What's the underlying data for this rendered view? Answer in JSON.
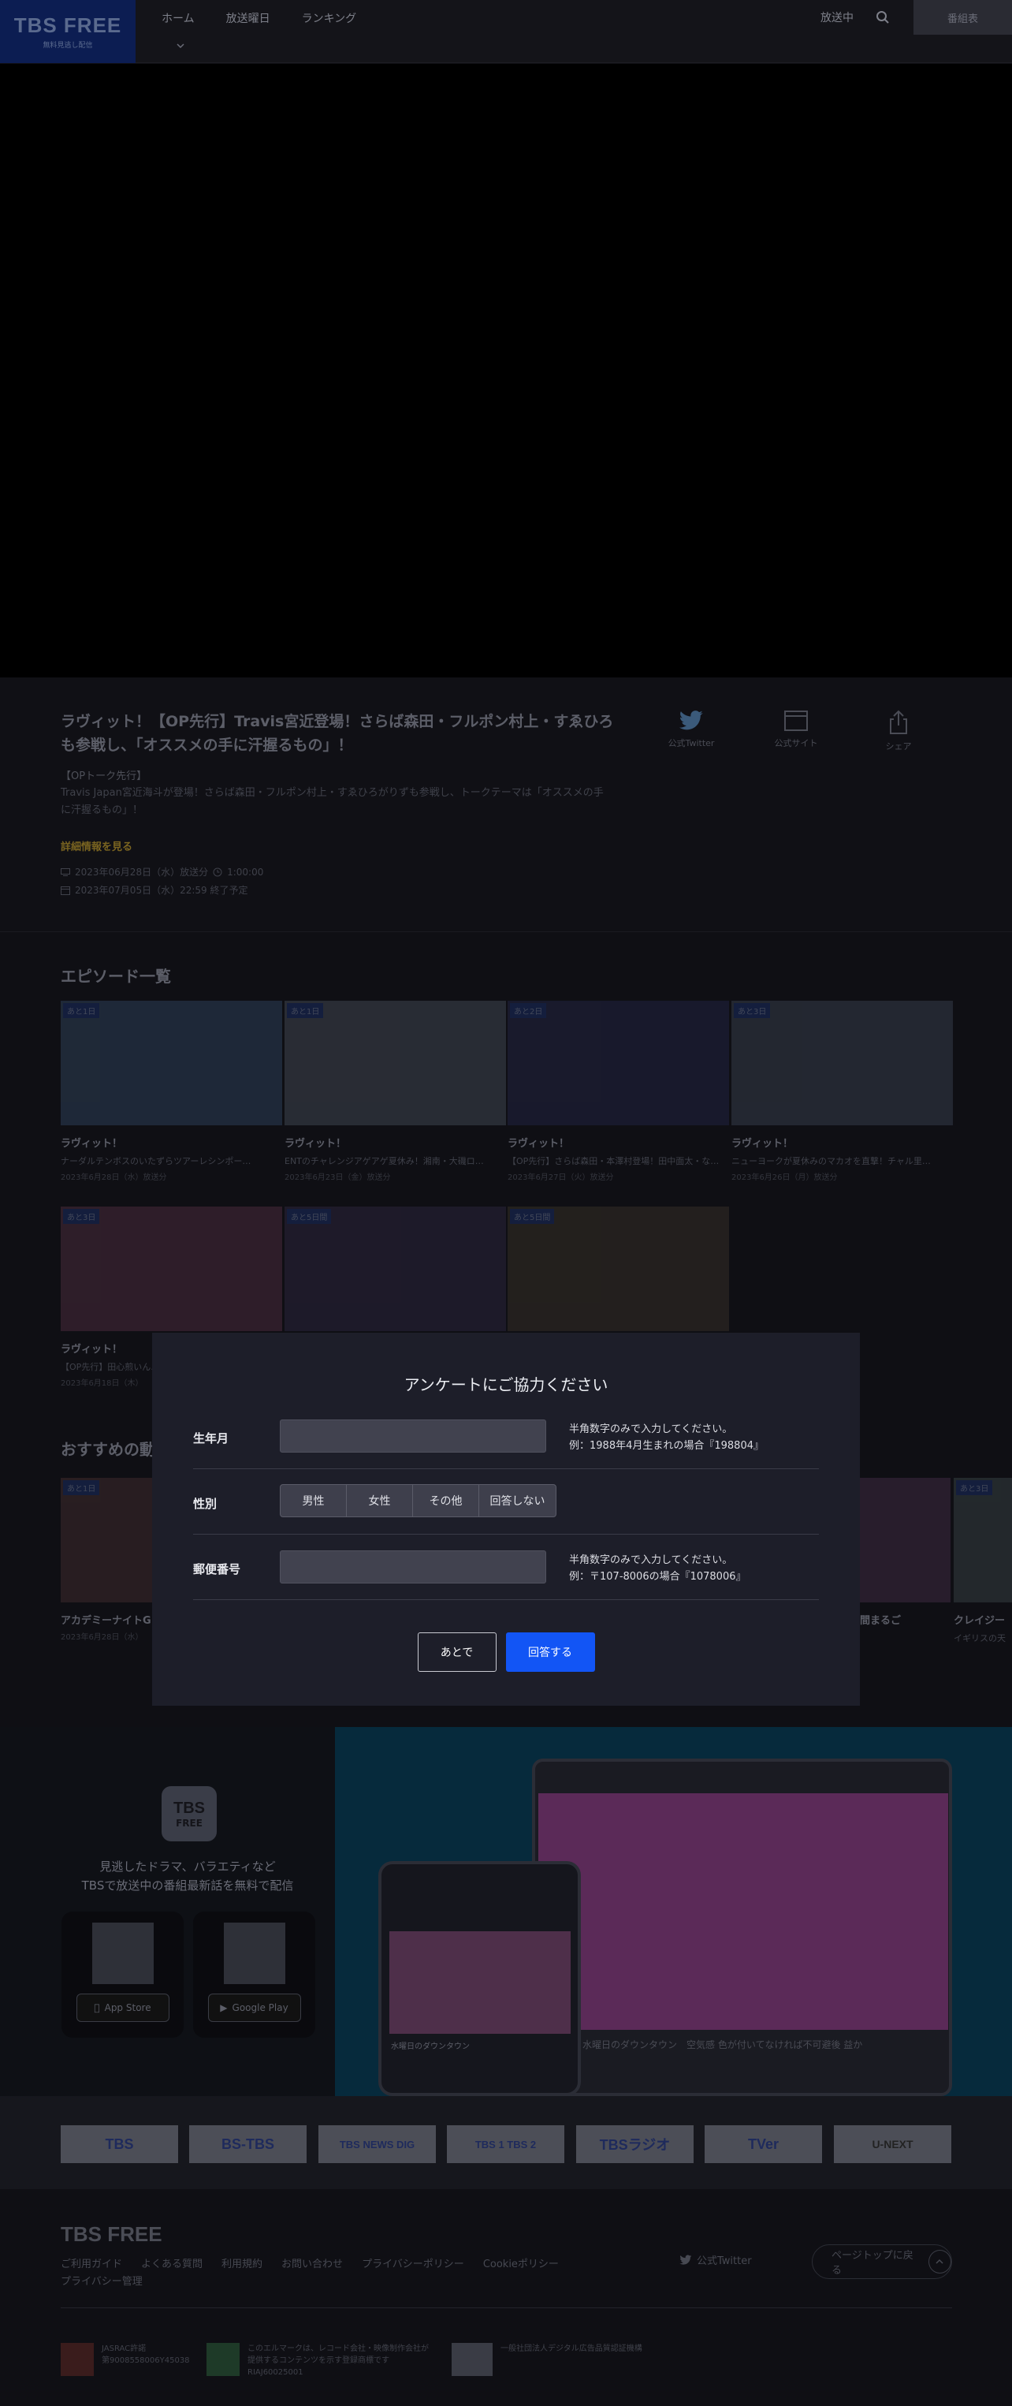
{
  "header": {
    "logo_main": "TBS FREE",
    "logo_sub": "無料見逃し配信",
    "nav": [
      "ホーム",
      "放送曜日",
      "ランキング"
    ],
    "now_airing": "放送中",
    "program_list": "番組表"
  },
  "episode": {
    "title": "ラヴィット！【OP先行】Travis宮近登場！さらば森田・フルポン村上・すゑひろも参戦し、「オススメの手に汗握るもの」！",
    "subtitle": "【OPトーク先行】",
    "description": "Travis Japan宮近海斗が登場！さらば森田・フルポン村上・すゑひろがりずも参戦し、トークテーマは「オススメの手に汗握るもの」！",
    "more_link": "詳細情報を見る",
    "broadcast": "2023年06月28日（水）放送分",
    "duration": "1:00:00",
    "expires": "2023年07月05日（水）22:59 終了予定",
    "actions": [
      "公式Twitter",
      "公式サイト",
      "シェア"
    ]
  },
  "episodes_section": {
    "title": "エピソード一覧",
    "cards": [
      {
        "badge": "あと1日",
        "program": "ラヴィット！",
        "desc": "ナーダルテンボスのいたずらツアーレシンポー…",
        "date": "2023年6月28日（水）放送分",
        "color": "#3d5a7a"
      },
      {
        "badge": "あと1日",
        "program": "ラヴィット！",
        "desc": "ENTのチャレンジアゲアゲ夏休み！湘南・大磯ロ…",
        "date": "2023年6月23日（金）放送分",
        "color": "#5a6470"
      },
      {
        "badge": "あと2日",
        "program": "ラヴィット！",
        "desc": "【OP先行】さらば森田・本澤村登場！田中面太・な…",
        "date": "2023年6月27日（火）放送分",
        "color": "#2c2f5a"
      },
      {
        "badge": "あと3日",
        "program": "ラヴィット！",
        "desc": "ニューヨークが夏休みのマカオを直撃！チャル里…",
        "date": "2023年6月26日（月）放送分",
        "color": "#4a5566"
      },
      {
        "badge": "あと3日",
        "program": "ラヴィット！",
        "desc": "【OP先行】田心煎いん…",
        "date": "2023年6月18日（木）",
        "color": "#6a3a50"
      },
      {
        "badge": "あと5日間",
        "program": "",
        "desc": "",
        "date": "",
        "color": "#3a3050"
      },
      {
        "badge": "あと5日間",
        "program": "",
        "desc": "",
        "date": "",
        "color": "#4a4030"
      }
    ]
  },
  "recommend_section": {
    "title": "おすすめの動",
    "cards": [
      {
        "badge": "あと1日",
        "program": "アカデミーナイトG",
        "desc": "",
        "date": "2023年6月28日（水）",
        "color": "#5a3a3a"
      },
      {
        "badge": "",
        "program": "～1時間まるご",
        "desc": "",
        "date": "",
        "color": "#5a3a5a"
      },
      {
        "badge": "あと3日",
        "program": "クレイジー",
        "desc": "イギリスの天",
        "date": "",
        "color": "#4a5a5a"
      }
    ]
  },
  "survey": {
    "title": "アンケートにご協力ください",
    "birth_label": "生年月",
    "birth_note_1": "半角数字のみで入力してください。",
    "birth_note_2": "例：1988年4月生まれの場合『198804』",
    "gender_label": "性別",
    "gender_options": [
      "男性",
      "女性",
      "その他",
      "回答しない"
    ],
    "postal_label": "郵便番号",
    "postal_note_1": "半角数字のみで入力してください。",
    "postal_note_2": "例：〒107-8006の場合『1078006』",
    "later_button": "あとで",
    "answer_button": "回答する"
  },
  "promo": {
    "logo_1": "TBS",
    "logo_2": "FREE",
    "text_1": "見逃したドラマ、バラエティなど",
    "text_2": "TBSで放送中の番組最新話を無料で配信",
    "app_store": "App Store",
    "google_play": "Google Play",
    "tablet_caption": "水曜日のダウンタウン　空気感 色が付いてなければ不可避後 益か",
    "phone_title": "水曜日のダウンタウン"
  },
  "partners": [
    "TBS",
    "BS-TBS",
    "TBS NEWS DIG",
    "TBS 1 TBS 2",
    "TBSラジオ",
    "TVer",
    "U-NEXT"
  ],
  "footer": {
    "logo": "TBS FREE",
    "links": [
      "ご利用ガイド",
      "よくある質問",
      "利用規約",
      "お問い合わせ",
      "プライバシーポリシー",
      "Cookieポリシー"
    ],
    "privacy_mgmt": "プライバシー管理",
    "twitter": "公式Twitter",
    "page_top": "ページトップに戻る",
    "badge_1": "JASRAC許諾\n第9008558006Y45038",
    "badge_2": "このエルマークは、レコード会社・映像制作会社が\n提供するコンテンツを示す登録商標です\nRIAJ60025001",
    "badge_3": "一般社団法人デジタル広告品質認証機構"
  },
  "colors": {
    "accent": "#1255f5",
    "modal_bg": "#1d1e29",
    "logo_bg": "#0c1d52"
  }
}
